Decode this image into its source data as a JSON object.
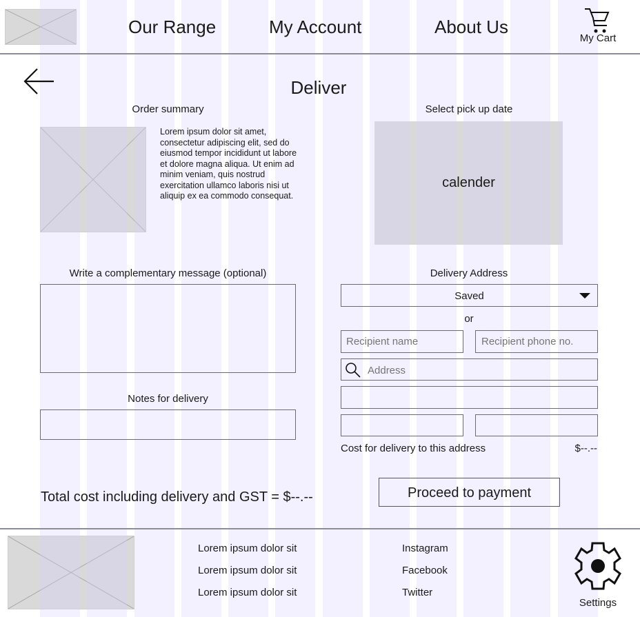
{
  "header": {
    "logo": "logo-placeholder-image",
    "nav": [
      {
        "label": "Our Range"
      },
      {
        "label": "My Account"
      },
      {
        "label": "About Us"
      }
    ],
    "cart": {
      "icon": "cart-icon",
      "label": "My Cart"
    }
  },
  "page": {
    "back_icon": "arrow-left-icon",
    "title": "Deliver"
  },
  "order_summary": {
    "heading": "Order summary",
    "image": "product-placeholder-image",
    "description": "Lorem ipsum dolor sit amet, consectetur adipiscing elit, sed do eiusmod tempor incididunt ut labore et dolore magna aliqua. Ut enim ad minim veniam, quis nostrud exercitation ullamco laboris nisi ut aliquip ex ea commodo consequat."
  },
  "pickup": {
    "heading": "Select pick up date",
    "calendar_label": "calender"
  },
  "message": {
    "heading": "Write a complementary message (optional)",
    "value": ""
  },
  "notes": {
    "heading": "Notes for delivery",
    "value": ""
  },
  "delivery_address": {
    "heading": "Delivery Address",
    "saved_select": {
      "selected": "Saved",
      "icon": "caret-down-icon"
    },
    "or_label": "or",
    "recipient_name": {
      "placeholder": "Recipient name",
      "value": ""
    },
    "recipient_phone": {
      "placeholder": "Recipient phone no.",
      "value": ""
    },
    "address": {
      "icon": "search-icon",
      "placeholder": "Address",
      "value": ""
    },
    "address_line2": {
      "value": ""
    },
    "field_left": {
      "value": ""
    },
    "field_right": {
      "value": ""
    },
    "cost_label": "Cost for delivery to this address",
    "cost_value": "$--.--"
  },
  "totals": {
    "total_text": "Total cost including delivery and GST = $--.--",
    "proceed_button": "Proceed to payment"
  },
  "footer": {
    "logo": "footer-placeholder-image",
    "links": [
      "Lorem ipsum dolor sit",
      "Lorem ipsum dolor sit",
      "Lorem ipsum dolor sit"
    ],
    "social": [
      "Instagram",
      "Facebook",
      "Twitter"
    ],
    "settings": {
      "icon": "gear-icon",
      "label": "Settings"
    }
  },
  "colors": {
    "grid_overlay": "#f1efff",
    "placeholder_fill": "#d9d9d9",
    "border": "#6a6a72",
    "placeholder_text": "#8e8e96"
  }
}
